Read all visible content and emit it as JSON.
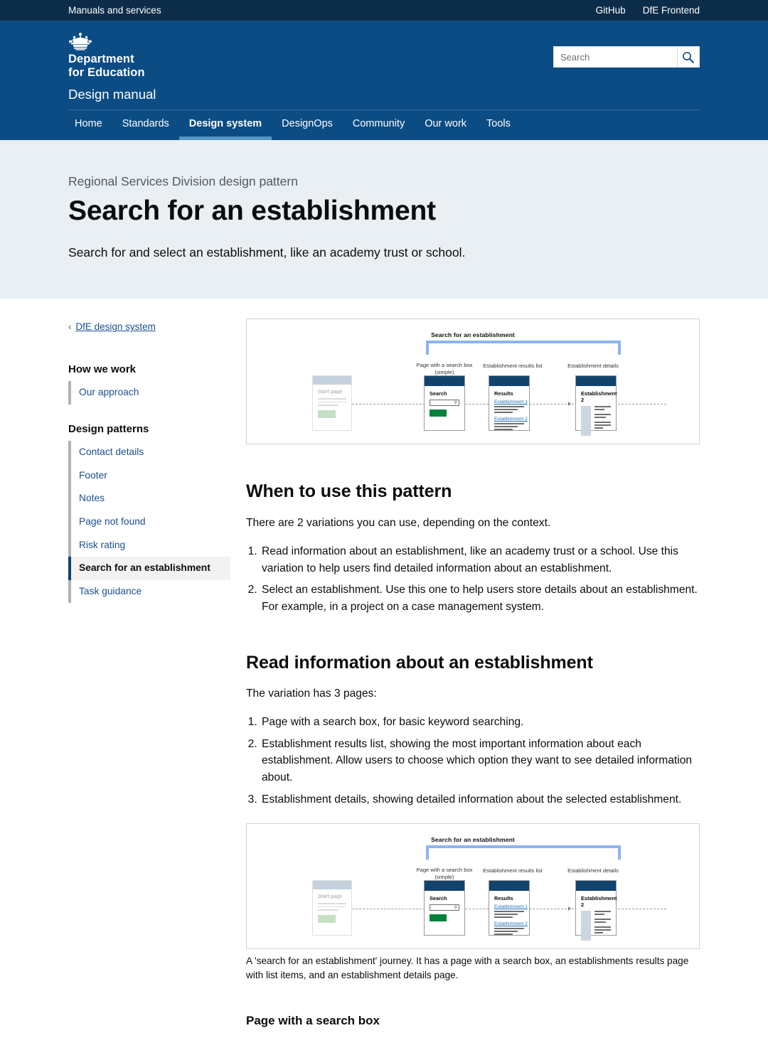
{
  "utility_bar": {
    "left_label": "Manuals and services",
    "links": [
      "GitHub",
      "DfE Frontend"
    ]
  },
  "header": {
    "crown_icon": "royal-crest-icon",
    "department": [
      "Department",
      "for Education"
    ],
    "service_name": "Design manual",
    "search": {
      "placeholder": "Search",
      "value": "",
      "button_icon": "search-icon"
    }
  },
  "nav": {
    "items": [
      {
        "label": "Home",
        "active": false
      },
      {
        "label": "Standards",
        "active": false
      },
      {
        "label": "Design system",
        "active": true
      },
      {
        "label": "DesignOps",
        "active": false
      },
      {
        "label": "Community",
        "active": false
      },
      {
        "label": "Our work",
        "active": false
      },
      {
        "label": "Tools",
        "active": false
      }
    ]
  },
  "hero": {
    "caption": "Regional Services Division design pattern",
    "title": "Search for an establishment",
    "subtitle": "Search for and select an establishment, like an academy trust or school."
  },
  "sidebar": {
    "back_link": {
      "chevron": "‹",
      "label": "DfE design system"
    },
    "groups": [
      {
        "title": "How we work",
        "items": [
          {
            "label": "Our approach",
            "active": false
          }
        ]
      },
      {
        "title": "Design patterns",
        "items": [
          {
            "label": "Contact details",
            "active": false
          },
          {
            "label": "Footer",
            "active": false
          },
          {
            "label": "Notes",
            "active": false
          },
          {
            "label": "Page not found",
            "active": false
          },
          {
            "label": "Risk rating",
            "active": false
          },
          {
            "label": "Search for an establishment",
            "active": true
          },
          {
            "label": "Task guidance",
            "active": false
          }
        ]
      }
    ]
  },
  "content": {
    "section_when": {
      "heading": "When to use this pattern",
      "intro": "There are 2 variations you can use, depending on the context.",
      "list": [
        "Read information about an establishment, like an academy trust or a school. Use this variation to help users find detailed information about an establishment.",
        "Select an establishment. Use this one to help users store details about an establishment. For example, in a project on a case management system."
      ]
    },
    "section_read": {
      "heading": "Read information about an establishment",
      "intro": "The variation has 3 pages:",
      "list": [
        "Page with a search box, for basic keyword searching.",
        "Establishment results list, showing the most important information about each establishment. Allow users to choose which option they want to see detailed information about.",
        "Establishment details, showing detailed information about the selected establishment."
      ],
      "figure_caption": "A 'search for an establishment' journey. It has a page with a search box, an establishments results page with list items, and an establishment details page."
    },
    "section_page_search_box": {
      "heading": "Page with a search box"
    }
  },
  "diagram": {
    "title": "Search for an establishment",
    "bracket_color": "#8cb4f2",
    "start_page": {
      "heading": "Start page"
    },
    "steps": [
      {
        "label": "Page with a search box\n(simple)",
        "heading": "Search",
        "field_icon": "search-icon",
        "button_color": "#00823b"
      },
      {
        "label": "Establishment results list",
        "heading": "Results",
        "links": [
          "Establishment 1",
          "Establishment 2"
        ]
      },
      {
        "label": "Establishment details",
        "heading": "Establishment 2"
      }
    ]
  },
  "colors": {
    "header_blue": "#0b4c84",
    "utility_blue": "#0c2d4a",
    "hero_bg": "#e9eff3",
    "link_blue": "#1d4f91",
    "active_border": "#12436d",
    "tab_underline": "#5694ca",
    "green_button": "#00823b"
  }
}
